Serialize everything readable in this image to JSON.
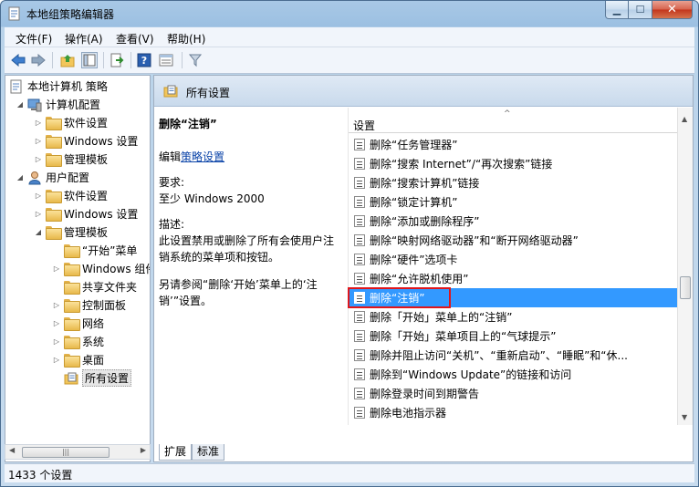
{
  "window": {
    "title": "本地组策略编辑器"
  },
  "menu": {
    "file": "文件(F)",
    "action": "操作(A)",
    "view": "查看(V)",
    "help": "帮助(H)"
  },
  "tree": {
    "root": "本地计算机 策略",
    "computer_config": "计算机配置",
    "cc_software": "软件设置",
    "cc_windows": "Windows 设置",
    "cc_admin": "管理模板",
    "user_config": "用户配置",
    "uc_software": "软件设置",
    "uc_windows": "Windows 设置",
    "uc_admin": "管理模板",
    "start_menu": "“开始”菜单",
    "windows_components": "Windows 组件",
    "shared_folders": "共享文件夹",
    "control_panel": "控制面板",
    "network": "网络",
    "system": "系统",
    "desktop": "桌面",
    "all_settings": "所有设置"
  },
  "header": {
    "title": "所有设置"
  },
  "description": {
    "title": "删除“注销”",
    "edit_prefix": "编辑",
    "edit_link": "策略设置",
    "requirements_label": "要求:",
    "requirements_value": "至少 Windows 2000",
    "desc_label": "描述:",
    "desc_text": "此设置禁用或删除了所有会使用户注销系统的菜单项和按钮。",
    "see_also": "另请参阅“删除‘开始’菜单上的‘注销’”设置。"
  },
  "list": {
    "column_header": "设置",
    "items": [
      "删除“任务管理器”",
      "删除“搜索 Internet”/“再次搜索”链接",
      "删除“搜索计算机”链接",
      "删除“锁定计算机”",
      "删除“添加或删除程序”",
      "删除“映射网络驱动器”和“断开网络驱动器”",
      "删除“硬件”选项卡",
      "删除“允许脱机使用”",
      "删除“注销”",
      "删除「开始」菜单上的“注销”",
      "删除「开始」菜单项目上的“气球提示”",
      "删除并阻止访问“关机”、“重新启动”、“睡眠”和“休...",
      "删除到“Windows Update”的链接和访问",
      "删除登录时间到期警告",
      "删除电池指示器"
    ]
  },
  "tabs": {
    "extended": "扩展",
    "standard": "标准"
  },
  "status": {
    "text": "1433 个设置"
  }
}
